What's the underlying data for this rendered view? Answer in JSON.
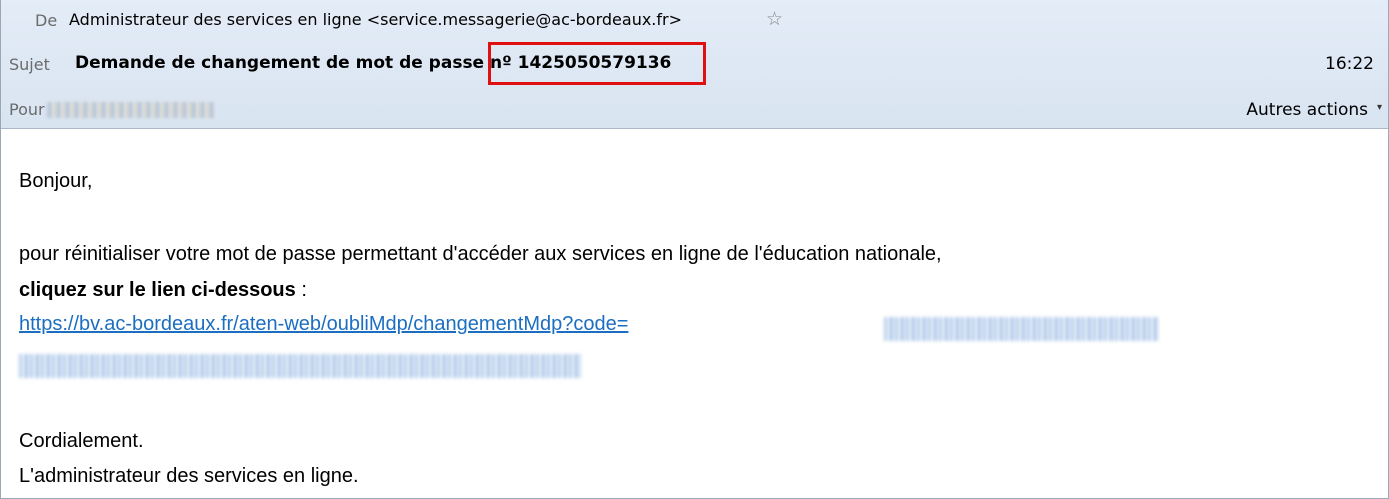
{
  "header": {
    "from_label": "De",
    "from_value": "Administrateur des services en ligne <service.messagerie@ac-bordeaux.fr>",
    "star_icon": "☆",
    "subject_label": "Sujet",
    "subject_value": "Demande de changement de mot de passe nº 1425050579136",
    "time": "16:22",
    "to_label": "Pour",
    "other_actions": "Autres actions",
    "other_actions_caret": "▾"
  },
  "body": {
    "greeting": "Bonjour,",
    "intro": "pour réinitialiser votre mot de passe permettant d'accéder aux services en ligne de l'éducation nationale,",
    "instruction_bold": "cliquez sur le lien ci-dessous",
    "instruction_rest": " :",
    "link": "https://bv.ac-bordeaux.fr/aten-web/oubliMdp/changementMdp?code=",
    "closing": "Cordialement.",
    "signature": "L'administrateur des services en ligne."
  },
  "colors": {
    "highlight": "#e01010",
    "link": "#1c6fc0",
    "header_bg": "#dfe8f4"
  }
}
